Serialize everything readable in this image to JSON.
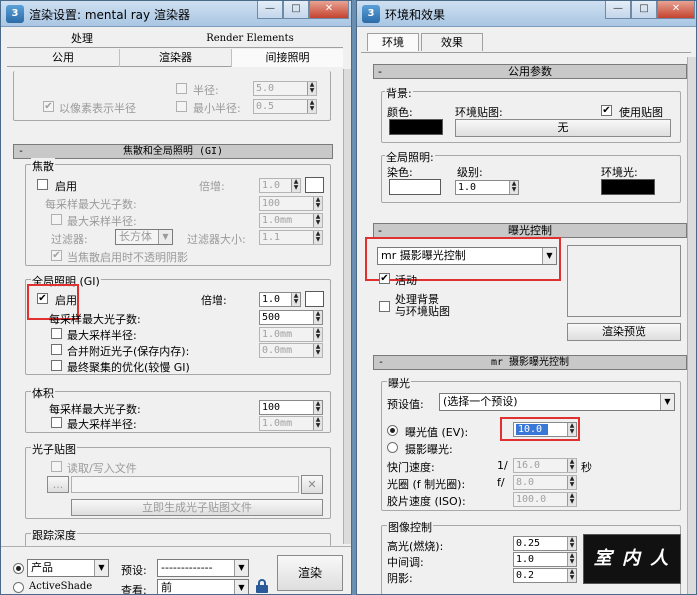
{
  "left_window": {
    "title": "渲染设置: mental ray 渲染器",
    "app_icon": "3",
    "tabs_row1": [
      "处理",
      "Render Elements"
    ],
    "tabs_row2": [
      "公用",
      "渲染器",
      "间接照明"
    ],
    "top_partial": {
      "radius_label": "半径:",
      "radius_value": "5.0",
      "pixels_label": "以像素表示半径",
      "min_radius_label": "最小半径:",
      "min_radius_value": "0.5"
    },
    "gi_rollout": "焦散和全局照明 (GI)",
    "caustics": {
      "group": "焦散",
      "enable": "启用",
      "multiplier_label": "倍增:",
      "multiplier_value": "1.0",
      "max_photons_label": "每采样最大光子数:",
      "max_photons_value": "100",
      "max_radius_label": "最大采样半径:",
      "max_radius_value": "1.0mm",
      "filter_label": "过滤器:",
      "filter_value": "长方体",
      "filter_size_label": "过滤器大小:",
      "filter_size_value": "1.1",
      "opaque_label": "当焦散启用时不透明阴影"
    },
    "gi": {
      "group": "全局照明 (GI)",
      "enable": "启用",
      "multiplier_label": "倍增:",
      "multiplier_value": "1.0",
      "max_photons_label": "每采样最大光子数:",
      "max_photons_value": "500",
      "max_radius_label": "最大采样半径:",
      "max_radius_value": "1.0mm",
      "merge_label": "合并附近光子(保存内存):",
      "merge_value": "0.0mm",
      "optimize_label": "最终聚集的优化(较慢 GI)"
    },
    "volume": {
      "group": "体积",
      "max_photons_label": "每采样最大光子数:",
      "max_photons_value": "100",
      "max_radius_label": "最大采样半径:",
      "max_radius_value": "1.0mm"
    },
    "photon_map": {
      "group": "光子贴图",
      "read_write": "读取/写入文件",
      "browse": "...",
      "generate": "立即生成光子贴图文件"
    },
    "trace_depth": {
      "group": "跟踪深度"
    },
    "bottom": {
      "product_label": "产品",
      "activeshade_label": "ActiveShade",
      "preset_label": "预设:",
      "preset_value": "-------------",
      "view_label": "查看:",
      "view_value": "前",
      "render_button": "渲染"
    }
  },
  "right_window": {
    "title": "环境和效果",
    "app_icon": "3",
    "tabs": [
      "环境",
      "效果"
    ],
    "common_rollout": "公用参数",
    "background": {
      "group": "背景:",
      "color_label": "颜色:",
      "color_hex": "#000000",
      "env_map_label": "环境贴图:",
      "use_map_label": "使用贴图",
      "map_button": "无"
    },
    "global_lighting": {
      "group": "全局照明:",
      "tint_label": "染色:",
      "tint_hex": "#ffffff",
      "level_label": "级别:",
      "level_value": "1.0",
      "ambient_label": "环境光:",
      "ambient_hex": "#000000"
    },
    "exposure_rollout": "曝光控制",
    "exposure": {
      "type_value": "mr 摄影曝光控制",
      "active_label": "活动",
      "process_bg_label": "处理背景",
      "process_bg_label2": "与环境贴图",
      "render_preview": "渲染预览"
    },
    "mr_rollout": "mr 摄影曝光控制",
    "mr_exposure": {
      "group": "曝光",
      "preset_label": "预设值:",
      "preset_value": "(选择一个预设)",
      "ev_label": "曝光值 (EV):",
      "ev_value": "10.0",
      "photo_label": "摄影曝光:",
      "shutter_label": "快门速度:",
      "shutter_prefix": "1/",
      "shutter_value": "16.0",
      "shutter_unit": "秒",
      "aperture_label": "光圈 (f 制光圈):",
      "aperture_prefix": "f/",
      "aperture_value": "8.0",
      "iso_label": "胶片速度 (ISO):",
      "iso_value": "100.0"
    },
    "image_control": {
      "group": "图像控制",
      "highlights_label": "高光(燃烧):",
      "highlights_value": "0.25",
      "midtones_label": "中间调:",
      "midtones_value": "1.0",
      "shadows_label": "阴影:",
      "shadows_value": "0.2",
      "watermark_text": "室 内 人"
    }
  }
}
